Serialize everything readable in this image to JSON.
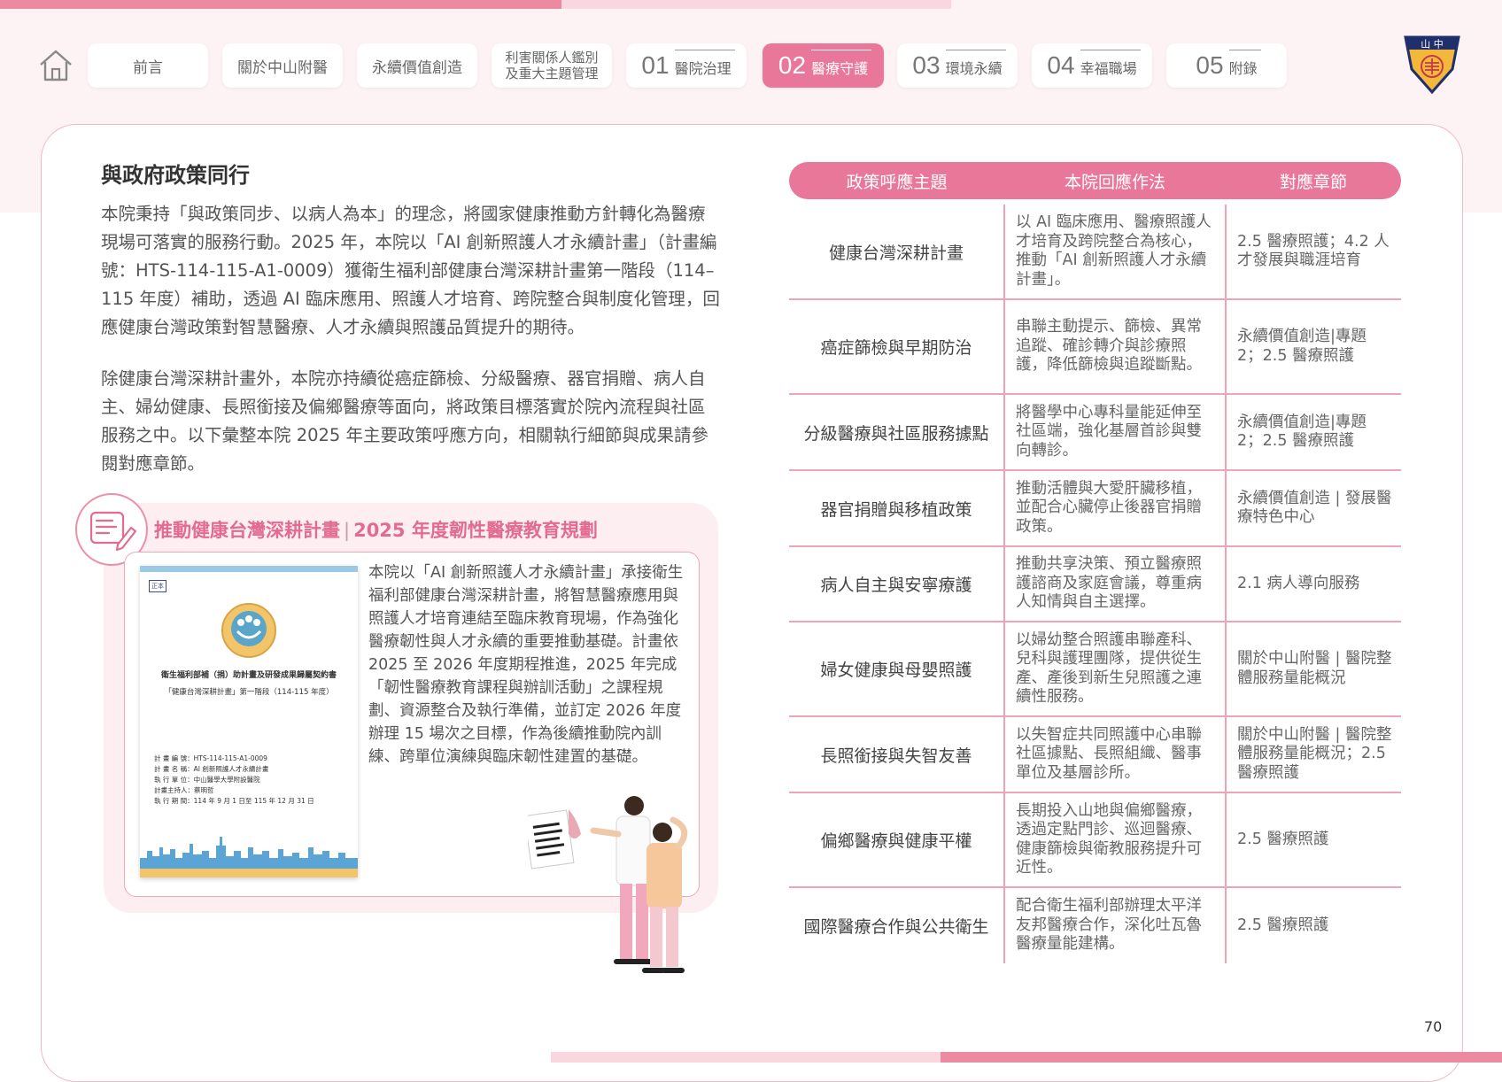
{
  "nav": {
    "items": [
      {
        "label": "前言"
      },
      {
        "label": "關於中山附醫"
      },
      {
        "label": "永續價值創造"
      },
      {
        "label_line1": "利害關係人鑑別",
        "label_line2": "及重大主題管理"
      },
      {
        "num": "01",
        "label": "醫院治理"
      },
      {
        "num": "02",
        "label": "醫療守護",
        "active": true
      },
      {
        "num": "03",
        "label": "環境永續"
      },
      {
        "num": "04",
        "label": "幸福職場"
      },
      {
        "num": "05",
        "label": "附錄"
      }
    ],
    "logo_text": "山中",
    "accent_color": "#e9779a"
  },
  "main": {
    "title": "與政府政策同行",
    "paragraph1": "本院秉持「與政策同步、以病人為本」的理念，將國家健康推動方針轉化為醫療現場可落實的服務行動。2025 年，本院以「AI 創新照護人才永續計畫」（計畫編號：HTS-114-115-A1-0009）獲衛生福利部健康台灣深耕計畫第一階段（114–115 年度）補助，透過 AI 臨床應用、照護人才培育、跨院整合與制度化管理，回應健康台灣政策對智慧醫療、人才永續與照護品質提升的期待。",
    "paragraph2": "除健康台灣深耕計畫外，本院亦持續從癌症篩檢、分級醫療、器官捐贈、病人自主、婦幼健康、長照銜接及偏鄉醫療等面向，將政策目標落實於院內流程與社區服務之中。以下彙整本院 2025 年主要政策呼應方向，相關執行細節與成果請參閱對應章節。"
  },
  "highlight": {
    "title_a": "推動健康台灣深耕計畫",
    "title_b": "2025 年度韌性醫療教育規劃",
    "text": "本院以「AI 創新照護人才永續計畫」承接衛生福利部健康台灣深耕計畫，將智慧醫療應用與照護人才培育連結至臨床教育現場，作為強化醫療韌性與人才永續的重要推動基礎。計畫依 2025 至 2026 年度期程推進，2025 年完成「韌性醫療教育課程與辦訓活動」之課程規劃、資源整合及執行準備，並訂定 2026 年度辦理 15 場次之目標，作為後續推動院內訓練、跨單位演練與臨床韌性建置的基礎。",
    "certificate": {
      "stamp": "正本",
      "title": "衛生福利部補（捐）助計畫及研發成果歸屬契約書",
      "subtitle": "「健康台灣深耕計畫」第一階段（114-115 年度）",
      "meta": [
        "計 畫 編 號：HTS-114-115-A1-0009",
        "計 畫 名 稱：AI 創新照護人才永續計畫",
        "執 行 單 位：中山醫學大學附設醫院",
        "計畫主持人：蔡明哲",
        "執 行 期 間：114 年 9 月 1 日至 115 年 12 月 31 日"
      ]
    }
  },
  "table": {
    "headers": [
      "政策呼應主題",
      "本院回應作法",
      "對應章節"
    ],
    "rows": [
      {
        "topic": "健康台灣深耕計畫",
        "action": "以 AI 臨床應用、醫療照護人才培育及跨院整合為核心，推動「AI 創新照護人才永續計畫」。",
        "chapter": "2.5 醫療照護；4.2 人才發展與職涯培育"
      },
      {
        "topic": "癌症篩檢與早期防治",
        "action": "串聯主動提示、篩檢、異常追蹤、確診轉介與診療照護，降低篩檢與追蹤斷點。",
        "chapter": "永續價值創造|專題 2；2.5 醫療照護"
      },
      {
        "topic": "分級醫療與社區服務據點",
        "action": "將醫學中心專科量能延伸至社區端，強化基層首診與雙向轉診。",
        "chapter": "永續價值創造|專題 2；2.5 醫療照護"
      },
      {
        "topic": "器官捐贈與移植政策",
        "action": "推動活體與大愛肝臟移植，並配合心臟停止後器官捐贈政策。",
        "chapter": "永續價值創造 | 發展醫療特色中心"
      },
      {
        "topic": "病人自主與安寧療護",
        "action": "推動共享決策、預立醫療照護諮商及家庭會議，尊重病人知情與自主選擇。",
        "chapter": "2.1 病人導向服務"
      },
      {
        "topic": "婦女健康與母嬰照護",
        "action": "以婦幼整合照護串聯產科、兒科與護理團隊，提供從生產、產後到新生兒照護之連續性服務。",
        "chapter": "關於中山附醫 | 醫院整體服務量能概況"
      },
      {
        "topic": "長照銜接與失智友善",
        "action": "以失智症共同照護中心串聯社區據點、長照組織、醫事單位及基層診所。",
        "chapter": "關於中山附醫 | 醫院整體服務量能概況；2.5 醫療照護"
      },
      {
        "topic": "偏鄉醫療與健康平權",
        "action": "長期投入山地與偏鄉醫療，透過定點門診、巡迴醫療、健康篩檢與衛教服務提升可近性。",
        "chapter": "2.5 醫療照護"
      },
      {
        "topic": "國際醫療合作與公共衛生",
        "action": "配合衛生福利部辦理太平洋友邦醫療合作，深化吐瓦魯醫療量能建構。",
        "chapter": "2.5 醫療照護"
      }
    ]
  },
  "page_number": "70"
}
